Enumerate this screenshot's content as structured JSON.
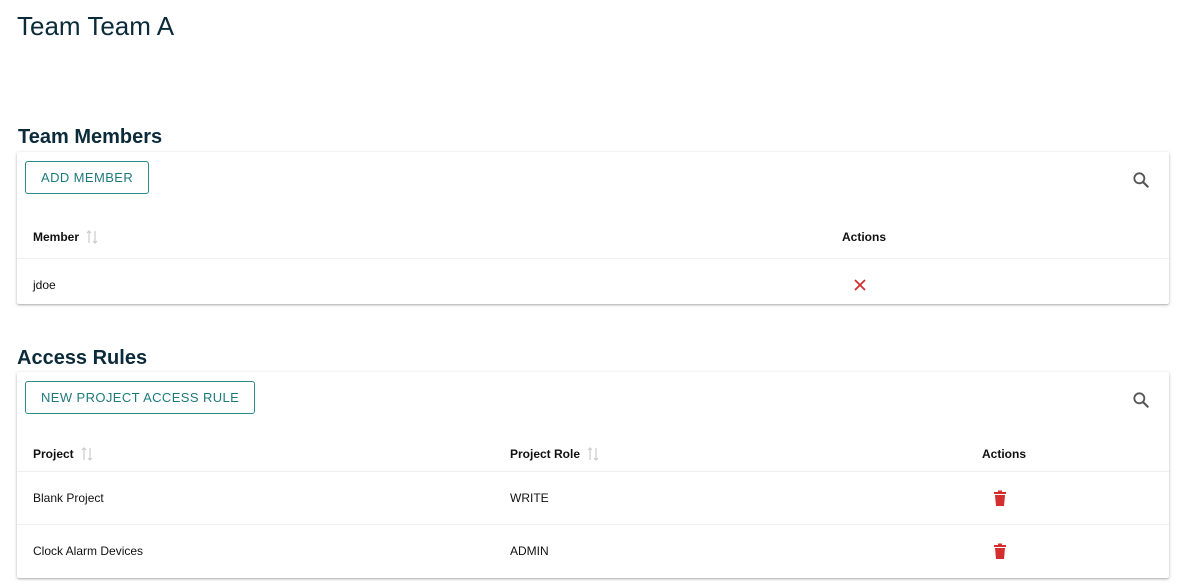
{
  "page": {
    "title": "Team Team A"
  },
  "members": {
    "section_title": "Team Members",
    "add_label": "ADD MEMBER",
    "columns": {
      "member": "Member",
      "actions": "Actions"
    },
    "rows": [
      {
        "member": "jdoe"
      }
    ]
  },
  "access": {
    "section_title": "Access Rules",
    "new_label": "NEW PROJECT ACCESS RULE",
    "columns": {
      "project": "Project",
      "role": "Project Role",
      "actions": "Actions"
    },
    "rows": [
      {
        "project": "Blank Project",
        "role": "WRITE"
      },
      {
        "project": "Clock Alarm Devices",
        "role": "ADMIN"
      }
    ]
  },
  "colors": {
    "accent": "#1f7a7d",
    "danger": "#d32f2f",
    "text": "#0b2a3a"
  },
  "icons": {
    "search": "search-icon",
    "sort": "sort-icon",
    "remove": "close-icon",
    "delete": "trash-icon"
  }
}
